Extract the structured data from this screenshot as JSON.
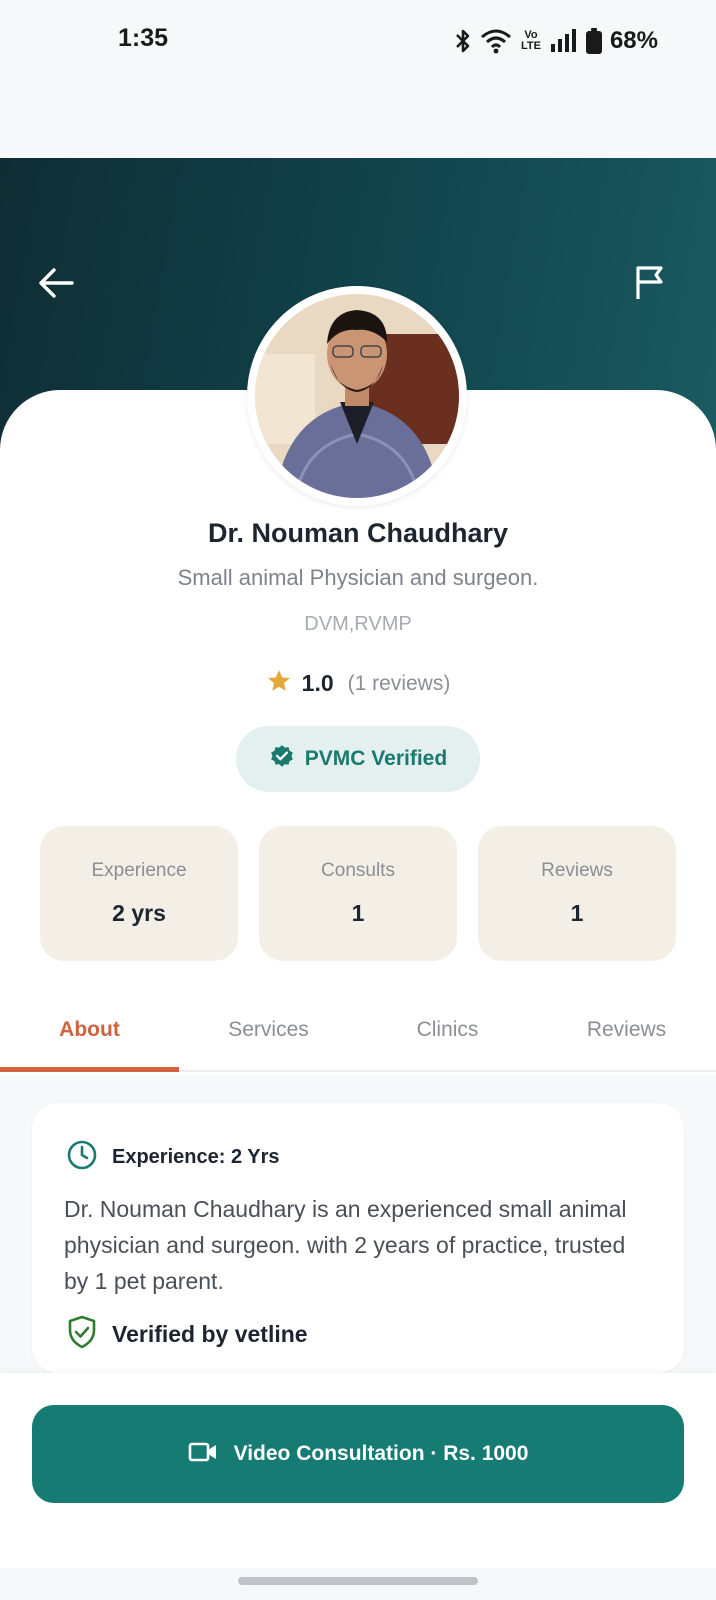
{
  "status_bar": {
    "time": "1:35",
    "network_label": "Vo LTE",
    "battery": "68%",
    "icons": [
      "bluetooth-icon",
      "wifi-icon",
      "volte-icon",
      "signal-icon",
      "battery-icon"
    ]
  },
  "header": {
    "back_icon": "arrow-left-icon",
    "report_icon": "flag-icon",
    "gradient_colors": [
      "#0f2d34",
      "#12474f",
      "#1b5a60"
    ]
  },
  "doctor": {
    "name": "Dr. Nouman Chaudhary",
    "title": "Small animal Physician and surgeon.",
    "degrees": "DVM,RVMP",
    "rating": "1.0",
    "reviews_text": "(1 reviews)",
    "rating_value": 1.0,
    "verified_label": "PVMC Verified"
  },
  "stats": [
    {
      "label": "Experience",
      "value": "2 yrs"
    },
    {
      "label": "Consults",
      "value": "1"
    },
    {
      "label": "Reviews",
      "value": "1"
    }
  ],
  "tabs": [
    {
      "label": "About",
      "active": true
    },
    {
      "label": "Services",
      "active": false
    },
    {
      "label": "Clinics",
      "active": false
    },
    {
      "label": "Reviews",
      "active": false
    }
  ],
  "about": {
    "experience_heading": "Experience: 2 Yrs",
    "description": "Dr. Nouman Chaudhary is an experienced small animal physician and surgeon. with 2 years of practice, trusted by 1 pet parent.",
    "verified_text": "Verified by vetline"
  },
  "cta": {
    "label": "Video Consultation · Rs. 1000",
    "icon": "video-camera-icon"
  },
  "colors": {
    "primary": "#167c73",
    "accent": "#d2623d",
    "star": "#e3a93a",
    "stat_bg": "#f4efe6"
  }
}
